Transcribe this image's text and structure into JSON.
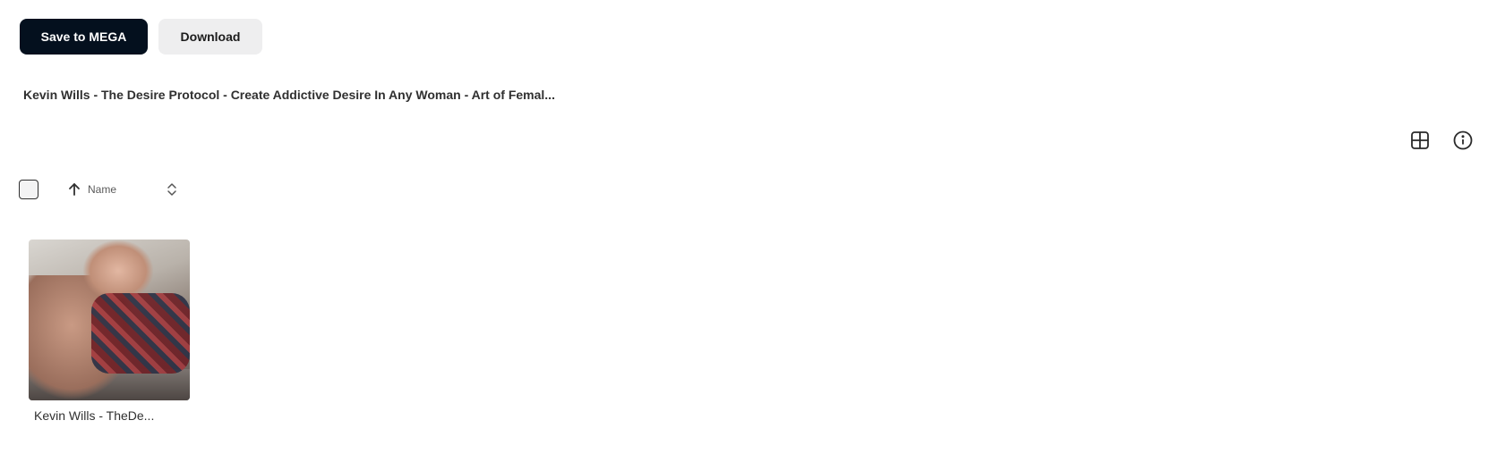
{
  "toolbar": {
    "save_label": "Save to MEGA",
    "download_label": "Download"
  },
  "folder": {
    "title": "Kevin Wills - The Desire Protocol - Create Addictive Desire In Any Woman - Art of Femal..."
  },
  "view": {
    "grid_icon": "grid-view-icon",
    "info_icon": "info-icon"
  },
  "sort": {
    "label": "Name",
    "direction": "ascending"
  },
  "files": [
    {
      "name": "Kevin Wills - TheDe...",
      "type": "image"
    }
  ],
  "colors": {
    "primary_button": "#04101e",
    "secondary_button": "#eeeeef"
  }
}
